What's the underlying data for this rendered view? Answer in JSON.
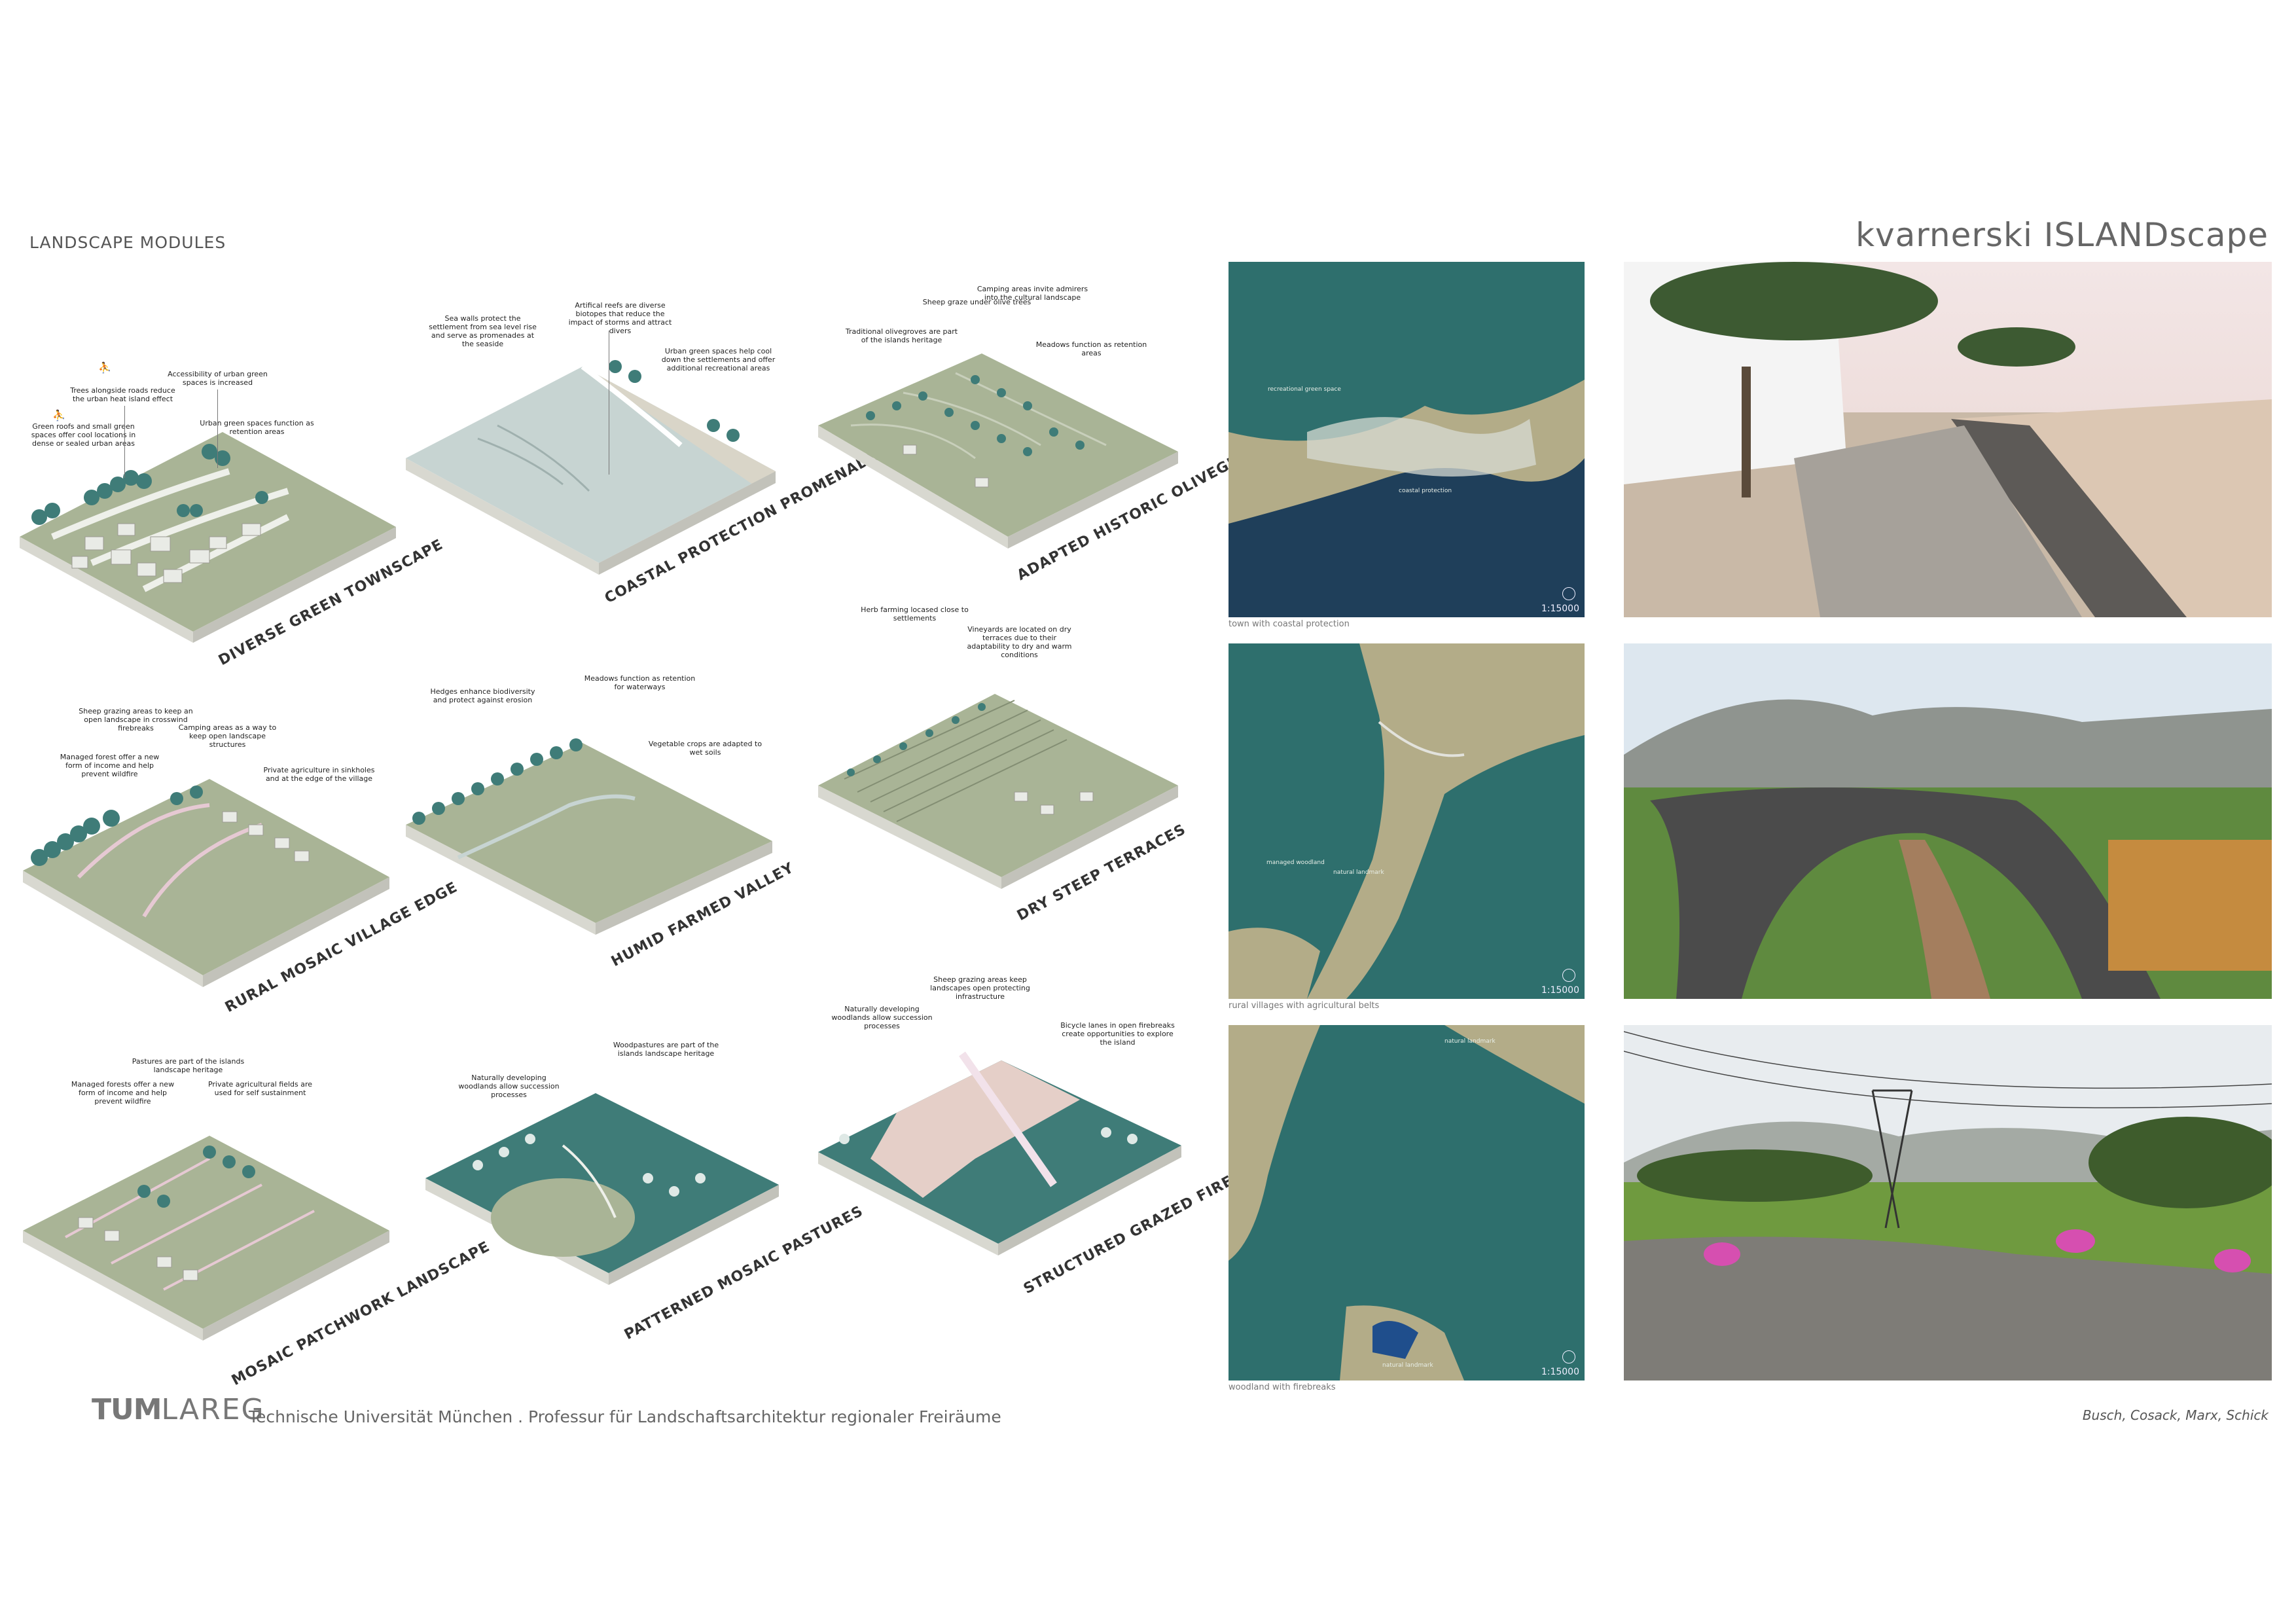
{
  "header": {
    "section_title": "LANDSCAPE MODULES",
    "project_title": "kvarnerski ISLANDscape"
  },
  "modules": [
    {
      "title": "DIVERSE GREEN TOWNSCAPE",
      "annotations": [
        "Accessibility of urban green spaces is increased",
        "Trees alongside roads reduce the urban heat island effect",
        "Green roofs and small green spaces offer cool locations in dense or sealed urban areas",
        "Urban green spaces function as retention areas"
      ]
    },
    {
      "title": "COASTAL PROTECTION PROMENADE",
      "annotations": [
        "Sea walls protect the settlement from sea level rise and serve as promenades at the seaside",
        "Artifical reefs are diverse biotopes that reduce the impact of storms and attract divers",
        "Urban green spaces help cool down the settlements and offer additional recreational areas"
      ]
    },
    {
      "title": "ADAPTED HISTORIC OLIVEGROVES",
      "annotations": [
        "Sheep graze under olive trees",
        "Camping areas invite admirers into the cultural landscape",
        "Traditional olivegroves are part of the islands heritage",
        "Meadows function as retention areas"
      ]
    },
    {
      "title": "RURAL MOSAIC VILLAGE EDGE",
      "annotations": [
        "Sheep grazing areas to keep an open landscape in crosswind firebreaks",
        "Camping areas as a way to keep open landscape structures",
        "Managed forest offer a new form of income and help prevent wildfire",
        "Private agriculture in sinkholes and at the edge of the village"
      ]
    },
    {
      "title": "HUMID FARMED VALLEY",
      "annotations": [
        "Meadows function as retention for waterways",
        "Hedges enhance biodiversity and protect against erosion",
        "Vegetable crops are adapted to wet soils"
      ]
    },
    {
      "title": "DRY STEEP TERRACES",
      "annotations": [
        "Herb farming locased close to settlements",
        "Vineyards are located on dry terraces due to their adaptability to dry and warm conditions"
      ]
    },
    {
      "title": "MOSAIC PATCHWORK LANDSCAPE",
      "annotations": [
        "Pastures are part of the islands landscape heritage",
        "Managed forests offer a new form of income and help prevent wildfire",
        "Private agricultural fields are used for self sustainment"
      ]
    },
    {
      "title": "PATTERNED MOSAIC PASTURES",
      "annotations": [
        "Woodpastures are part of the islands landscape heritage",
        "Naturally developing woodlands allow succession processes"
      ]
    },
    {
      "title": "STRUCTURED GRAZED FIREBREAK",
      "annotations": [
        "Sheep grazing areas keep landscapes open protecting infrastructure",
        "Naturally developing woodlands allow succession processes",
        "Bicycle lanes in open firebreaks create opportunities to explore the island"
      ]
    }
  ],
  "maps": [
    {
      "caption": "town with coastal protection",
      "scale": "1:15000",
      "labels": [
        "recreational green space",
        "coastal protection"
      ]
    },
    {
      "caption": "rural villages with agricultural belts",
      "scale": "1:15000",
      "labels": [
        "managed woodland",
        "natural landmark"
      ]
    },
    {
      "caption": "woodland with firebreaks",
      "scale": "1:15000",
      "labels": [
        "natural landmark",
        "natural landmark"
      ]
    }
  ],
  "footer": {
    "logo_tum": "TUM",
    "logo_lareg": "LAREG",
    "institution": "Technische Universität München . Professur für Landschaftsarchitektur regionaler Freiräume",
    "authors": "Busch, Cosack, Marx, Schick"
  },
  "colors": {
    "tree": "#3f7c78",
    "tree_light": "#dfe9e6",
    "meadow": "#a9b496",
    "meadow_dark": "#838e73",
    "sea": "#c7d4d2",
    "map_forest": "#2e6f6d",
    "map_field": "#a89f76",
    "map_sea": "#1f3f5a"
  }
}
